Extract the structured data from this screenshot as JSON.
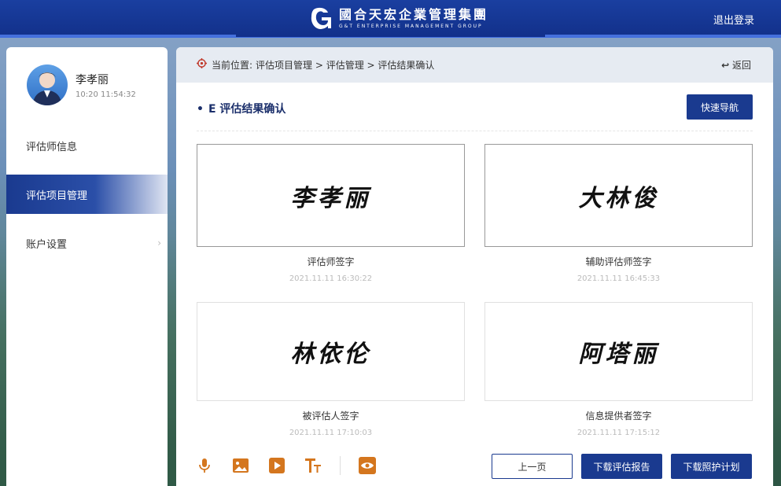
{
  "header": {
    "logo_cn": "國合天宏企業管理集團",
    "logo_en": "G&T  ENTERPRISE  MANAGEMENT  GROUP",
    "logout_label": "退出登录"
  },
  "user": {
    "name": "李孝丽",
    "time": "10:20  11:54:32"
  },
  "sidebar": {
    "items": [
      {
        "label": "评估师信息"
      },
      {
        "label": "评估项目管理"
      },
      {
        "label": "账户设置"
      }
    ]
  },
  "breadcrumb": {
    "prefix": "当前位置:",
    "path": "评估项目管理 > 评估管理 > 评估结果确认",
    "back_label": "返回"
  },
  "section": {
    "title": "E 评估结果确认",
    "quick_nav_label": "快速导航"
  },
  "signatures": [
    {
      "signature": "李孝丽",
      "label": "评估师签字",
      "time": "2021.11.11  16:30:22"
    },
    {
      "signature": "大林俊",
      "label": "辅助评估师签字",
      "time": "2021.11.11  16:45:33"
    },
    {
      "signature": "林依伦",
      "label": "被评估人签字",
      "time": "2021.11.11  17:10:03"
    },
    {
      "signature": "阿塔丽",
      "label": "信息提供者签字",
      "time": "2021.11.11  17:15:12"
    }
  ],
  "toolbar": {
    "icons": [
      "microphone-icon",
      "image-icon",
      "video-play-icon",
      "text-size-icon",
      "eye-icon"
    ],
    "accent": "#d4761e"
  },
  "buttons": {
    "prev_label": "上一页",
    "download_report_label": "下载评估报告",
    "download_plan_label": "下载照护计划"
  },
  "colors": {
    "primary": "#1a3a8f",
    "header": "#12308a"
  }
}
